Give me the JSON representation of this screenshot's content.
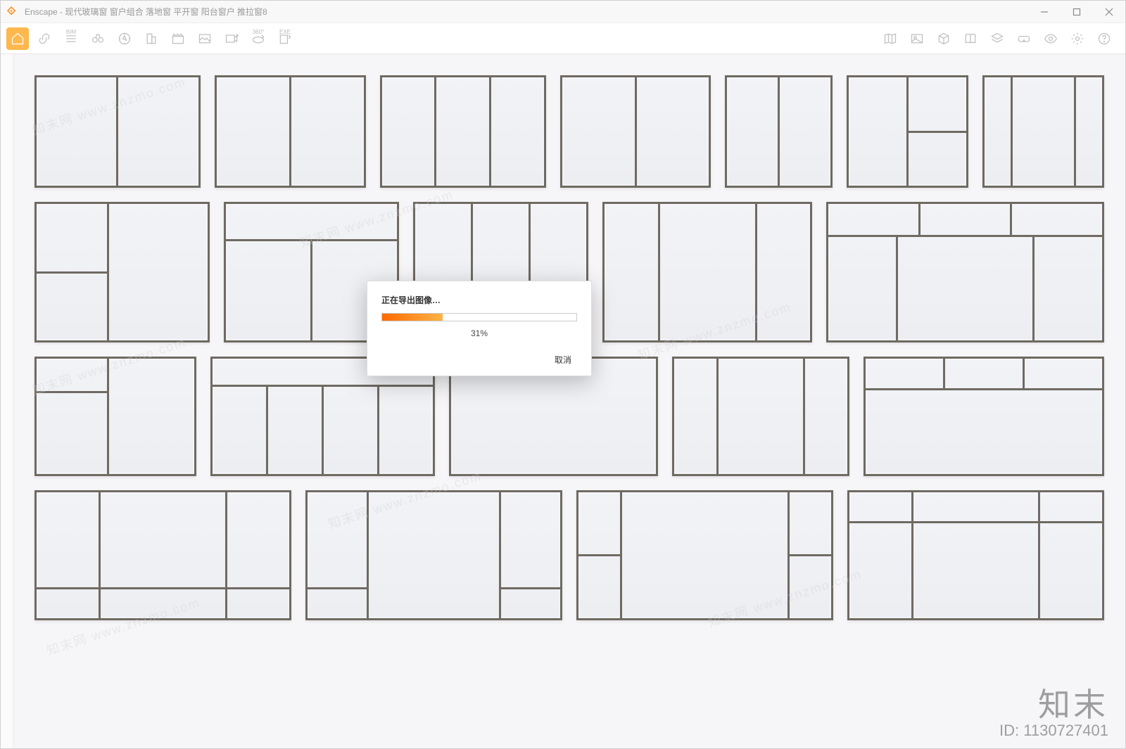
{
  "app": {
    "name": "Enscape",
    "title": "Enscape - 现代玻璃窗 窗户组合 落地窗 平开窗 阳台窗户 推拉窗8"
  },
  "window_controls": {
    "min": "—",
    "max": "□",
    "close": "✕"
  },
  "toolbar": {
    "left": [
      {
        "name": "home-icon"
      },
      {
        "name": "link-icon"
      },
      {
        "name": "bim-icon",
        "sub": "BIM"
      },
      {
        "name": "binoculars-icon"
      },
      {
        "name": "compass-icon"
      },
      {
        "name": "building-icon"
      },
      {
        "name": "clapper-icon"
      },
      {
        "name": "gallery-icon"
      },
      {
        "name": "export-video-icon"
      },
      {
        "name": "export-360-icon",
        "sub": "360°"
      },
      {
        "name": "export-exe-icon",
        "sub": "EXE"
      }
    ],
    "right": [
      {
        "name": "map-icon"
      },
      {
        "name": "image-icon"
      },
      {
        "name": "cube-icon"
      },
      {
        "name": "book-icon"
      },
      {
        "name": "layers-icon"
      },
      {
        "name": "vr-icon"
      },
      {
        "name": "eye-icon"
      },
      {
        "name": "gear-icon"
      },
      {
        "name": "help-icon"
      }
    ]
  },
  "modal": {
    "title": "正在导出图像…",
    "percent_label": "31%",
    "percent": 31,
    "cancel": "取消"
  },
  "watermark": {
    "brand": "知末",
    "id_label": "ID: 1130727401",
    "diag": "知末网 www.znzmo.com"
  }
}
